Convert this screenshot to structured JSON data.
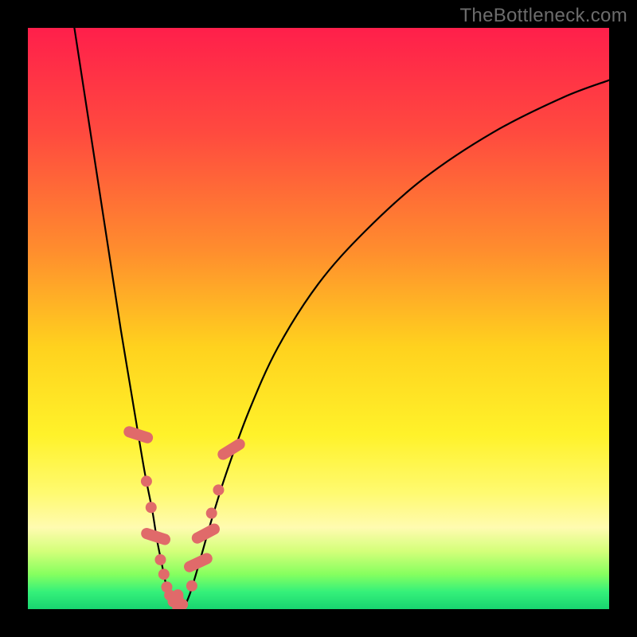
{
  "watermark": "TheBottleneck.com",
  "chart_data": {
    "type": "line",
    "title": "",
    "xlabel": "",
    "ylabel": "",
    "xlim": [
      0,
      100
    ],
    "ylim": [
      0,
      100
    ],
    "gradient_stops": [
      {
        "offset": 0.0,
        "color": "#ff1f4b"
      },
      {
        "offset": 0.18,
        "color": "#ff4a3f"
      },
      {
        "offset": 0.38,
        "color": "#ff8c2e"
      },
      {
        "offset": 0.55,
        "color": "#ffd21e"
      },
      {
        "offset": 0.7,
        "color": "#fff22a"
      },
      {
        "offset": 0.8,
        "color": "#fffa70"
      },
      {
        "offset": 0.86,
        "color": "#fffbb0"
      },
      {
        "offset": 0.9,
        "color": "#d4ff7a"
      },
      {
        "offset": 0.94,
        "color": "#86ff5f"
      },
      {
        "offset": 0.97,
        "color": "#35f17a"
      },
      {
        "offset": 1.0,
        "color": "#18d470"
      }
    ],
    "series": [
      {
        "name": "left-branch",
        "type": "curve",
        "x": [
          8,
          10,
          12,
          14,
          16,
          17.5,
          19,
          20.2,
          21.4,
          22.2,
          23,
          23.6,
          24.2,
          25
        ],
        "y": [
          100,
          87,
          74,
          61,
          48,
          39,
          30,
          23,
          17,
          12,
          8,
          5,
          2.5,
          0.5
        ]
      },
      {
        "name": "right-branch",
        "type": "curve",
        "x": [
          27,
          28,
          29.5,
          31.5,
          34,
          38,
          43,
          50,
          58,
          68,
          80,
          92,
          100
        ],
        "y": [
          0.5,
          3,
          8,
          15,
          23,
          34,
          45,
          56,
          65,
          74,
          82,
          88,
          91
        ]
      },
      {
        "name": "left-marker-cluster",
        "type": "scatter",
        "marker": "pill",
        "color": "#e06a6a",
        "points": [
          {
            "x": 19.0,
            "y": 30.0,
            "shape": "pill",
            "angle": -72
          },
          {
            "x": 20.4,
            "y": 22.0,
            "shape": "dot"
          },
          {
            "x": 21.2,
            "y": 17.5,
            "shape": "dot"
          },
          {
            "x": 22.0,
            "y": 12.5,
            "shape": "pill",
            "angle": -72
          },
          {
            "x": 22.8,
            "y": 8.5,
            "shape": "dot"
          },
          {
            "x": 23.4,
            "y": 6.0,
            "shape": "dot"
          },
          {
            "x": 23.9,
            "y": 3.8,
            "shape": "dot"
          },
          {
            "x": 24.4,
            "y": 2.4,
            "shape": "dot"
          },
          {
            "x": 25.0,
            "y": 1.3,
            "shape": "dot"
          },
          {
            "x": 25.8,
            "y": 0.8,
            "shape": "pill",
            "angle": 0
          },
          {
            "x": 26.6,
            "y": 0.8,
            "shape": "dot"
          }
        ]
      },
      {
        "name": "right-marker-cluster",
        "type": "scatter",
        "marker": "pill",
        "color": "#e06a6a",
        "points": [
          {
            "x": 28.2,
            "y": 4.0,
            "shape": "dot"
          },
          {
            "x": 29.3,
            "y": 8.0,
            "shape": "pill",
            "angle": 65
          },
          {
            "x": 30.6,
            "y": 13.0,
            "shape": "pill",
            "angle": 62
          },
          {
            "x": 31.6,
            "y": 16.5,
            "shape": "dot"
          },
          {
            "x": 32.8,
            "y": 20.5,
            "shape": "dot"
          },
          {
            "x": 35.0,
            "y": 27.5,
            "shape": "pill",
            "angle": 58
          }
        ]
      }
    ]
  }
}
